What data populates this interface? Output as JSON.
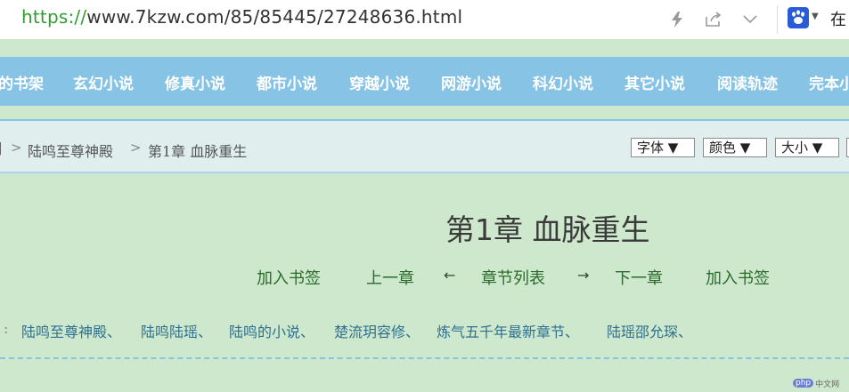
{
  "browser": {
    "url_scheme": "https://",
    "url_rest": "www.7kzw.com/85/85445/27248636.html",
    "right_char": "在"
  },
  "nav": {
    "items": [
      "的书架",
      "玄幻小说",
      "修真小说",
      "都市小说",
      "穿越小说",
      "网游小说",
      "科幻小说",
      "其它小说",
      "阅读轨迹",
      "完本小"
    ]
  },
  "breadcrumb": {
    "lead": "]",
    "book": "陆鸣至尊神殿",
    "chapter": "第1章  血脉重生",
    "sep": ">"
  },
  "controls": {
    "font": "字体 ▼",
    "color": "颜色 ▼",
    "size": "大小 ▼"
  },
  "chapter": {
    "title": "第1章  血脉重生",
    "links": {
      "bookmark1": "加入书签",
      "prev": "上一章",
      "left_arrow": "←",
      "toc": "章节列表",
      "right_arrow": "→",
      "next": "下一章",
      "bookmark2": "加入书签"
    }
  },
  "tags": {
    "lead": ":",
    "items": [
      "陆鸣至尊神殿、",
      "陆鸣陆瑶、",
      "陆鸣的小说、",
      "楚流玥容修、",
      "炼气五千年最新章节、",
      "陆瑶邵允琛、"
    ]
  },
  "watermark": {
    "badge": "php",
    "text": "中文网"
  }
}
